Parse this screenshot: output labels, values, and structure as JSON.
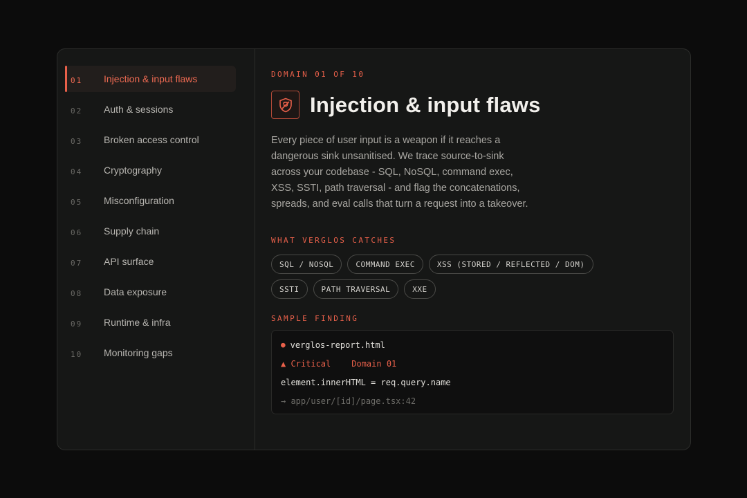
{
  "sidebar": {
    "items": [
      {
        "num": "01",
        "label": "Injection & input flaws"
      },
      {
        "num": "02",
        "label": "Auth & sessions"
      },
      {
        "num": "03",
        "label": "Broken access control"
      },
      {
        "num": "04",
        "label": "Cryptography"
      },
      {
        "num": "05",
        "label": "Misconfiguration"
      },
      {
        "num": "06",
        "label": "Supply chain"
      },
      {
        "num": "07",
        "label": "API surface"
      },
      {
        "num": "08",
        "label": "Data exposure"
      },
      {
        "num": "09",
        "label": "Runtime & infra"
      },
      {
        "num": "10",
        "label": "Monitoring gaps"
      }
    ],
    "active_index": 0
  },
  "main": {
    "eyebrow": "DOMAIN 01 OF 10",
    "title": "Injection & input flaws",
    "icon": "shield-bug-icon",
    "description": "Every piece of user input is a weapon if it reaches a dangerous sink unsanitised. We trace source-to-sink across your codebase - SQL, NoSQL, command exec, XSS, SSTI, path traversal - and flag the concatenations, spreads, and eval calls that turn a request into a takeover.",
    "catches_label": "WHAT VERGLOS CATCHES",
    "tags": [
      "SQL / NOSQL",
      "COMMAND EXEC",
      "XSS (STORED / REFLECTED / DOM)",
      "SSTI",
      "PATH TRAVERSAL",
      "XXE"
    ],
    "finding_label": "SAMPLE FINDING",
    "finding": {
      "file": "verglos-report.html",
      "severity": "▲ Critical",
      "domain": "Domain 01",
      "code": "element.innerHTML = req.query.name",
      "path": "→ app/user/[id]/page.tsx:42"
    }
  },
  "colors": {
    "accent": "#e8604a",
    "background": "#0c0c0c",
    "panel": "#161716"
  }
}
